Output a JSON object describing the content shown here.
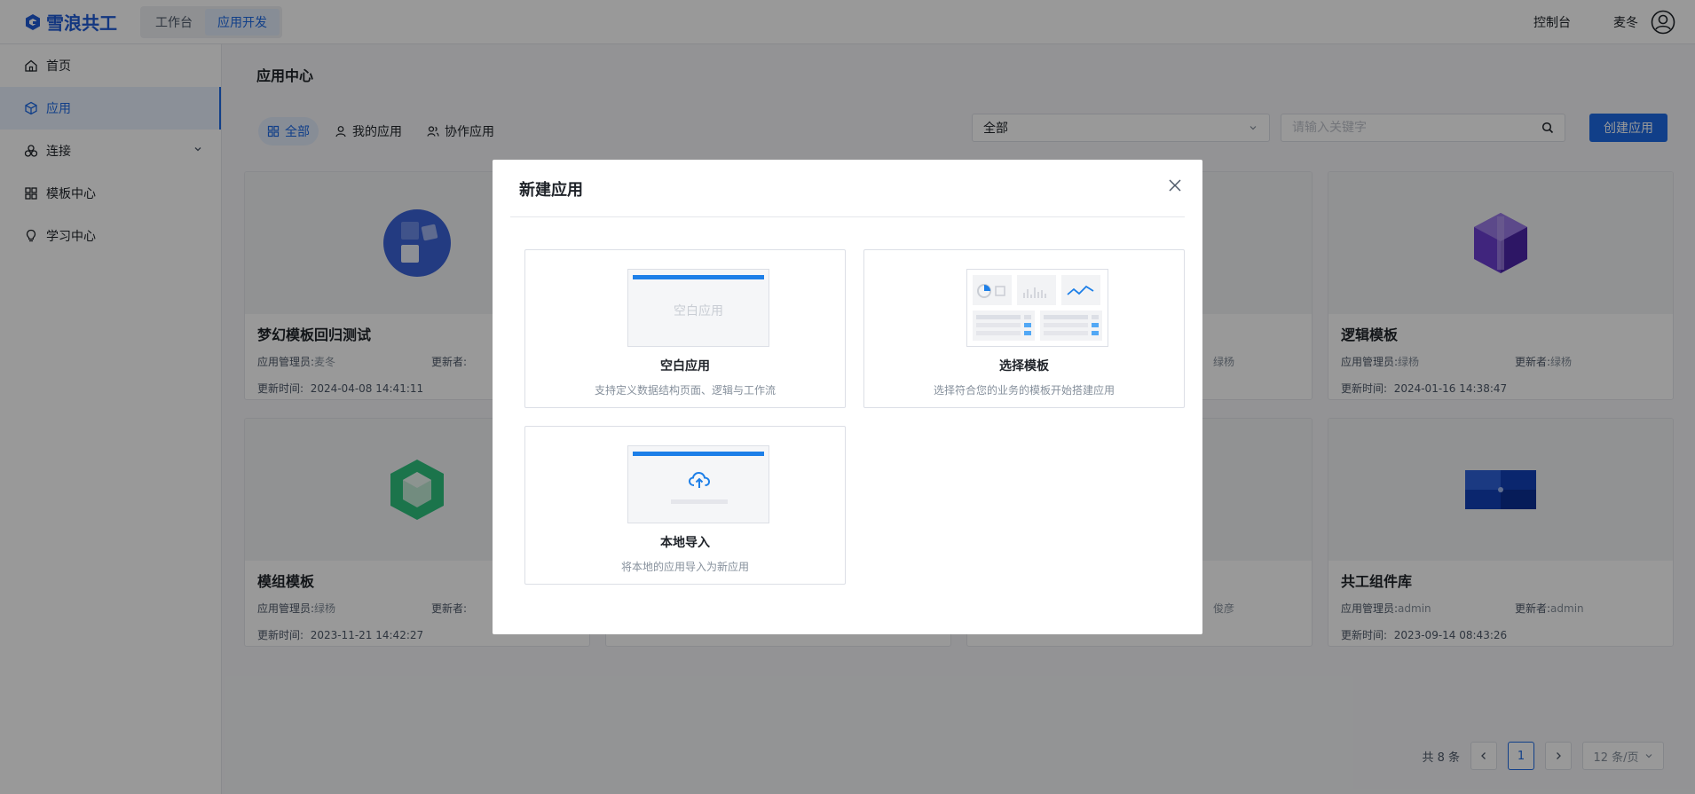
{
  "header": {
    "logo_text": "雪浪共工",
    "tabs": [
      "工作台",
      "应用开发"
    ],
    "control_link": "控制台",
    "user_name": "麦冬"
  },
  "sidebar": {
    "items": [
      {
        "label": "首页",
        "icon": "home-icon"
      },
      {
        "label": "应用",
        "icon": "cube-icon"
      },
      {
        "label": "连接",
        "icon": "connection-icon"
      },
      {
        "label": "模板中心",
        "icon": "grid-icon"
      },
      {
        "label": "学习中心",
        "icon": "bulb-icon"
      }
    ]
  },
  "main": {
    "title": "应用中心",
    "filters": [
      "全部",
      "我的应用",
      "协作应用"
    ],
    "select_value": "全部",
    "search_placeholder": "请输入关键字",
    "create_label": "创建应用"
  },
  "cards": [
    {
      "title": "梦幻模板回归测试",
      "manager_label": "应用管理员:",
      "manager": "麦冬",
      "updater_label": "更新者:",
      "updater": "",
      "time_label": "更新时间:",
      "time": "2024-04-08 14:41:11"
    },
    {
      "title": "逻辑模板",
      "manager_label": "应用管理员:",
      "manager": "绿杨",
      "updater_label": "更新者:",
      "updater": "绿杨",
      "time_label": "更新时间:",
      "time": "2024-01-16 14:38:47"
    },
    {
      "title": "模组模板",
      "manager_label": "应用管理员:",
      "manager": "绿杨",
      "updater_label": "更新者:",
      "updater": "",
      "time_label": "更新时间:",
      "time": "2023-11-21 14:42:27"
    },
    {
      "title": "共工组件库",
      "manager_label": "应用管理员:",
      "manager": "admin",
      "updater_label": "更新者:",
      "updater": "admin",
      "time_label": "更新时间:",
      "time": "2023-09-14 08:43:26"
    }
  ],
  "card_fragments": [
    "绿杨",
    "俊彦"
  ],
  "pagination": {
    "total": "共 8 条",
    "current": "1",
    "page_size": "12 条/页"
  },
  "modal": {
    "title": "新建应用",
    "options": [
      {
        "title": "空白应用",
        "desc": "支持定义数据结构页面、逻辑与工作流",
        "preview_text": "空白应用"
      },
      {
        "title": "选择模板",
        "desc": "选择符合您的业务的模板开始搭建应用"
      },
      {
        "title": "本地导入",
        "desc": "将本地的应用导入为新应用"
      }
    ]
  },
  "colors": {
    "primary": "#1d6ae5",
    "overlay": "rgba(0,0,0,0.4)"
  }
}
